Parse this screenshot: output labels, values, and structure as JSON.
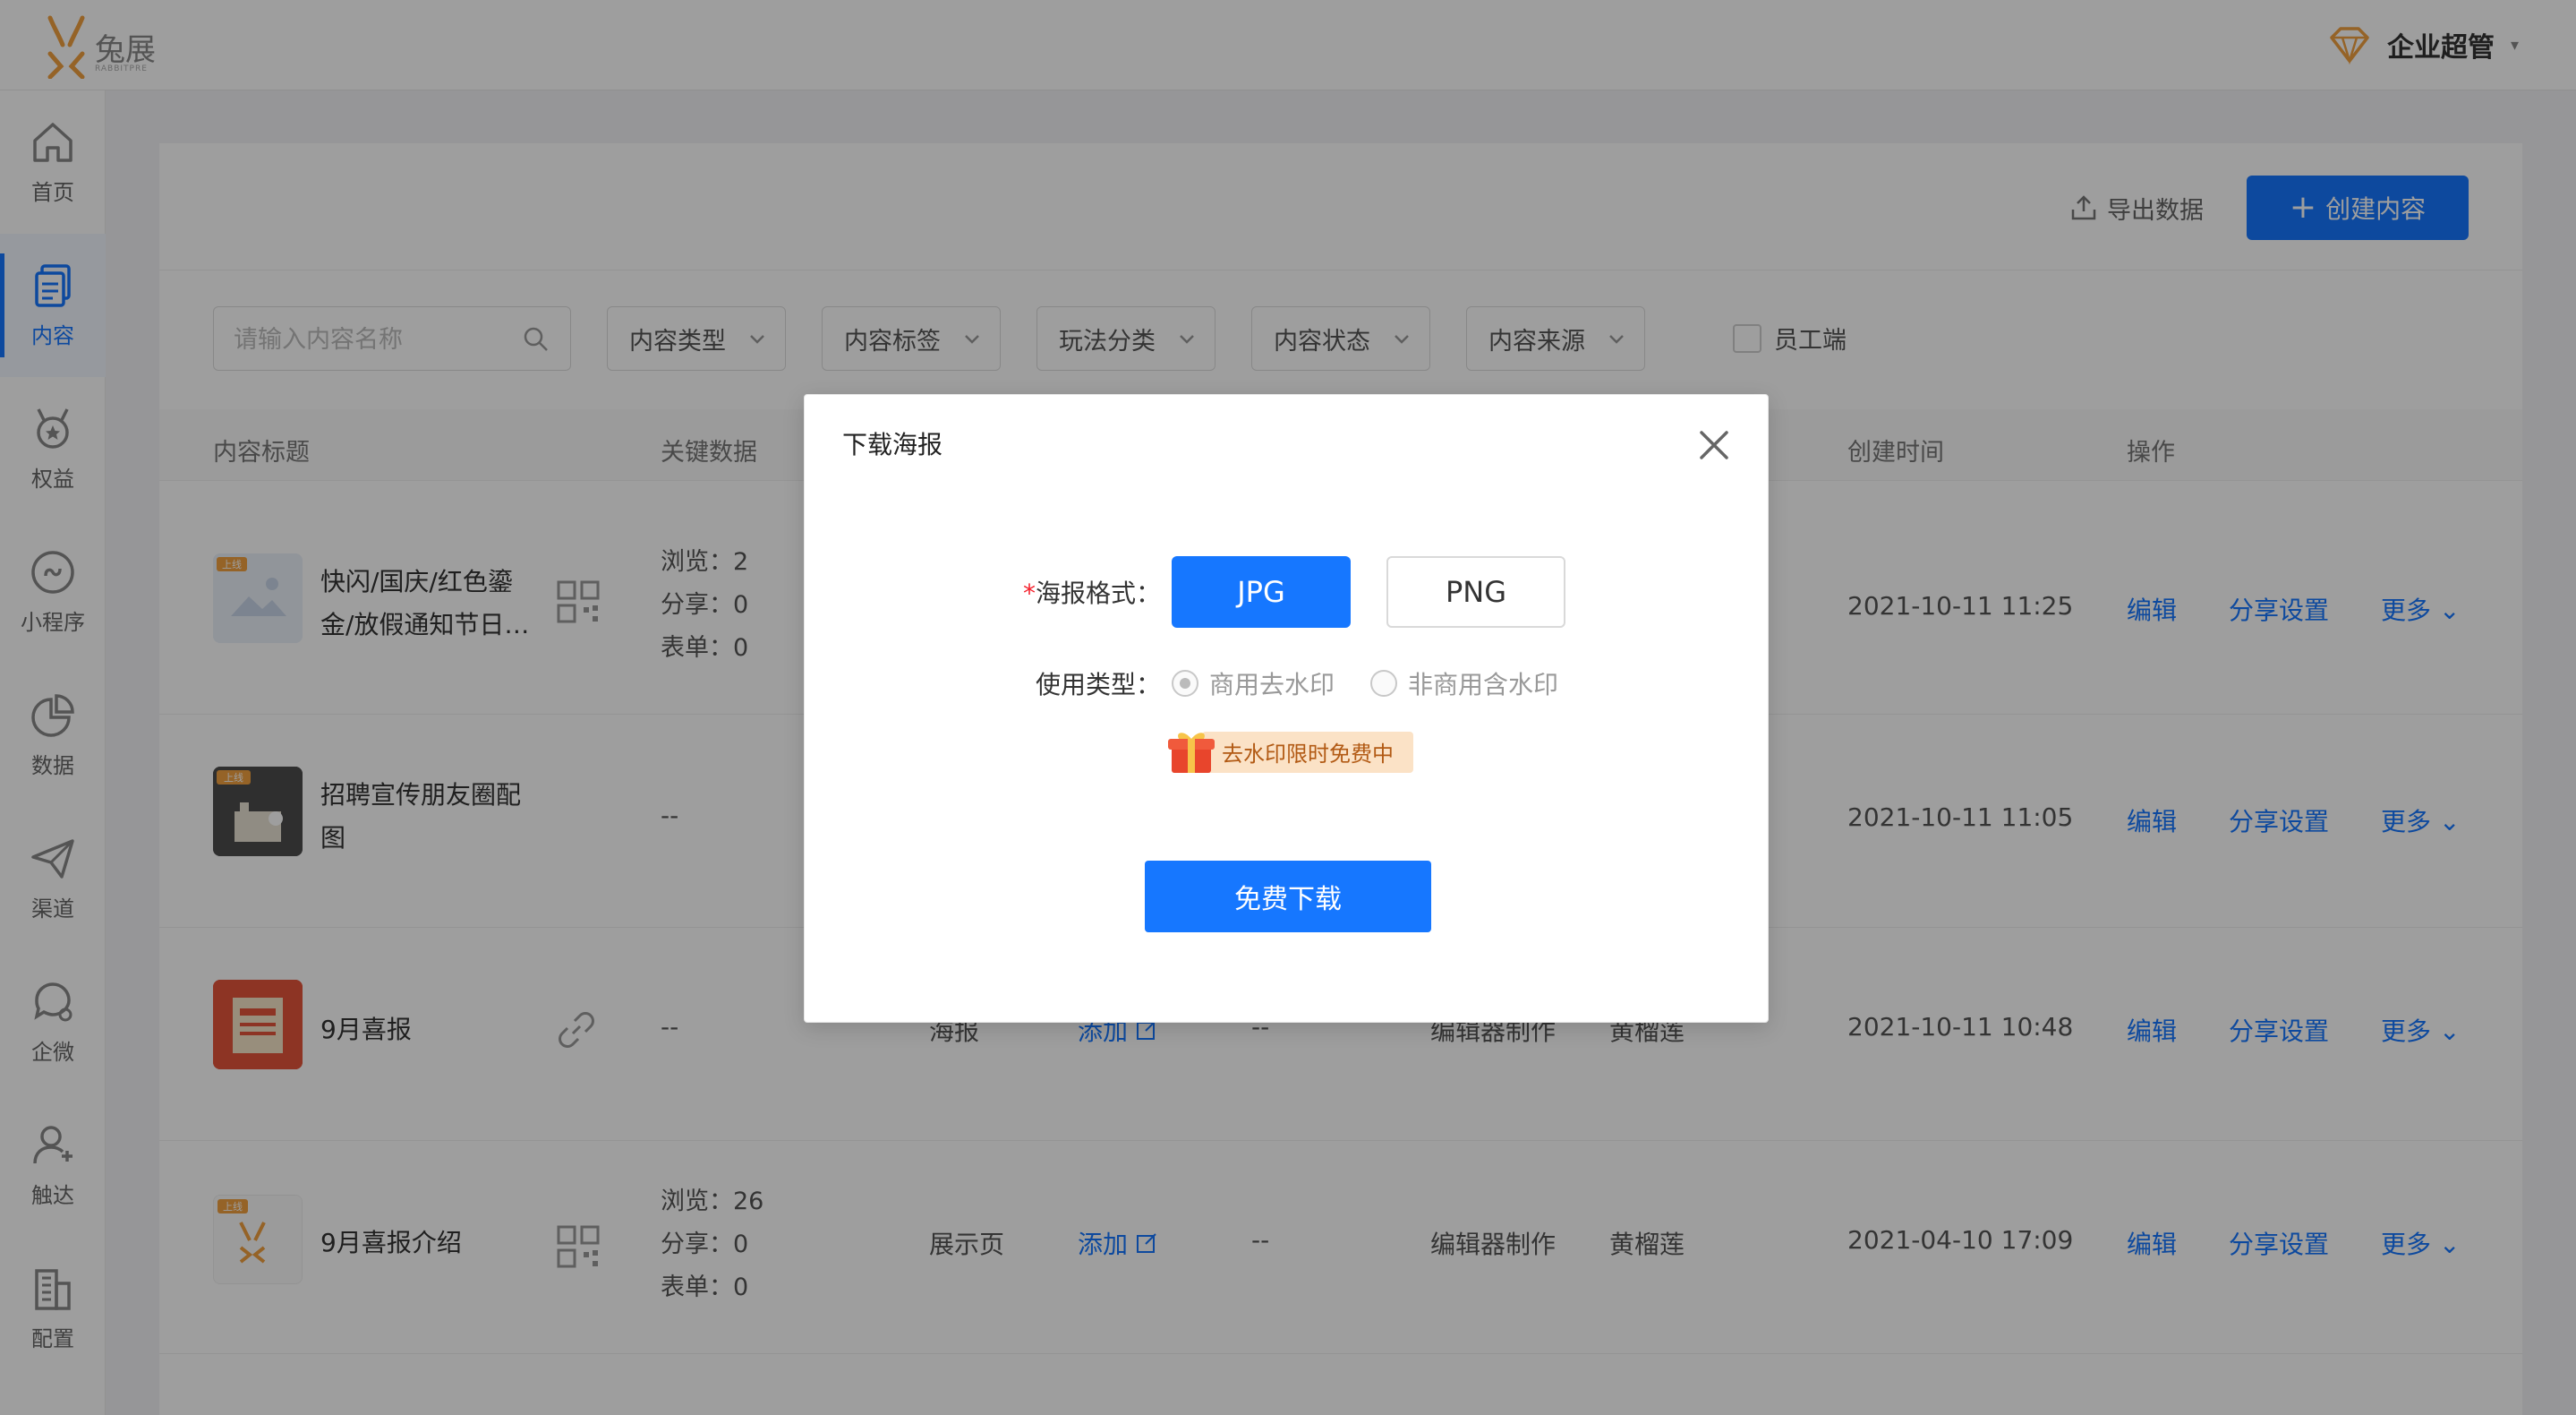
{
  "app": {
    "logo_text": "兔展",
    "logo_sub": "RABBITPRE",
    "user_name": "企业超管"
  },
  "sidebar": {
    "items": [
      {
        "label": "首页",
        "icon": "home-icon"
      },
      {
        "label": "内容",
        "icon": "document-icon",
        "active": true
      },
      {
        "label": "权益",
        "icon": "badge-icon"
      },
      {
        "label": "小程序",
        "icon": "miniprogram-icon"
      },
      {
        "label": "数据",
        "icon": "pie-chart-icon"
      },
      {
        "label": "渠道",
        "icon": "send-icon"
      },
      {
        "label": "企微",
        "icon": "wecom-icon"
      },
      {
        "label": "触达",
        "icon": "user-touch-icon"
      },
      {
        "label": "配置",
        "icon": "building-icon"
      }
    ]
  },
  "toolbar": {
    "export_label": "导出数据",
    "create_label": "创建内容"
  },
  "filters": {
    "search_placeholder": "请输入内容名称",
    "selects": [
      "内容类型",
      "内容标签",
      "玩法分类",
      "内容状态",
      "内容来源"
    ],
    "employee_label": "员工端"
  },
  "table": {
    "headers": [
      "内容标题",
      "关键数据",
      "创建时间",
      "操作"
    ],
    "rows": [
      {
        "title_line1": "快闪/国庆/红色鎏",
        "title_line2": "金/放假通知节日…",
        "stats": [
          "浏览：2",
          "分享：0",
          "表单：0"
        ],
        "created": "2021-10-11 11:25",
        "badge": "上线"
      },
      {
        "title_line1": "招聘宣传朋友圈配",
        "title_line2": "图",
        "key_data": "--",
        "created": "2021-10-11 11:05",
        "badge": "上线"
      },
      {
        "title_line1": "9月喜报",
        "key_data": "--",
        "type": "海报",
        "tag_link": "添加",
        "tag_value": "--",
        "source": "编辑器制作",
        "creator": "黄榴莲",
        "created": "2021-10-11 10:48"
      },
      {
        "title_line1": "9月喜报介绍",
        "stats": [
          "浏览：26",
          "分享：0",
          "表单：0"
        ],
        "type": "展示页",
        "tag_link": "添加",
        "tag_value": "--",
        "source": "编辑器制作",
        "creator": "黄榴莲",
        "created": "2021-04-10 17:09",
        "badge": "上线"
      }
    ],
    "actions": [
      "编辑",
      "分享设置",
      "更多"
    ]
  },
  "modal": {
    "title": "下载海报",
    "format_label": "海报格式：",
    "required_mark": "*",
    "formats": [
      "JPG",
      "PNG"
    ],
    "selected_format": "JPG",
    "usage_label": "使用类型：",
    "usage_options": [
      "商用去水印",
      "非商用含水印"
    ],
    "selected_usage": "商用去水印",
    "promo_text": "去水印限时免费中",
    "download_label": "免费下载"
  },
  "colors": {
    "primary": "#1677ff",
    "overlay": "rgba(0,0,0,0.38)",
    "promo_bg": "#fbe2c6",
    "promo_text": "#b25a14",
    "required": "#f5222d"
  }
}
